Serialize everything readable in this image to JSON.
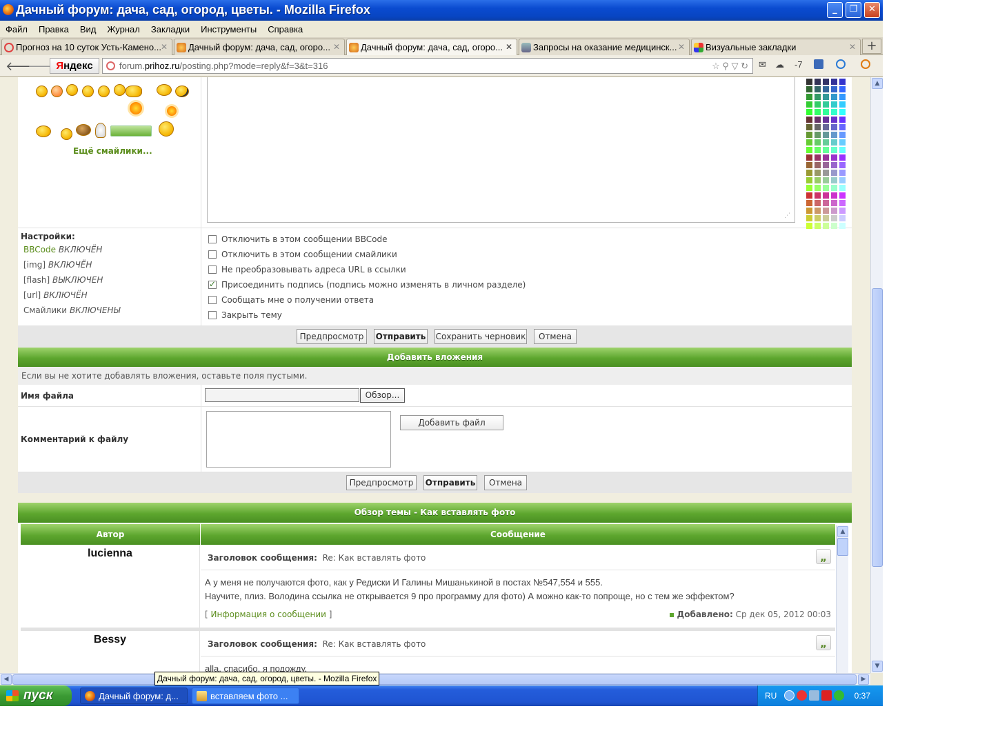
{
  "window": {
    "title": "Дачный форум: дача, сад, огород, цветы. - Mozilla Firefox",
    "buttons": {
      "minimize": "_",
      "maximize": "❐",
      "close": "✕"
    }
  },
  "menu": [
    "Файл",
    "Правка",
    "Вид",
    "Журнал",
    "Закладки",
    "Инструменты",
    "Справка"
  ],
  "tabs": [
    {
      "label": "Прогноз на 10 суток Усть-Камено...",
      "icon": "weather-icon",
      "active": false
    },
    {
      "label": "Дачный форум: дача, сад, огоро...",
      "icon": "forum-icon",
      "active": false
    },
    {
      "label": "Дачный форум: дача, сад, огоро...",
      "icon": "forum-icon",
      "active": true
    },
    {
      "label": "Запросы на оказание медицинск...",
      "icon": "page-icon",
      "active": false
    },
    {
      "label": "Визуальные закладки",
      "icon": "bookmarks-icon",
      "active": false
    }
  ],
  "tab_close": "✕",
  "new_tab": "+",
  "nav": {
    "back": "🡐",
    "forward": "🡒",
    "yandex": {
      "first": "Я",
      "rest": "ндекс"
    },
    "url": {
      "prefix": "forum.",
      "domain": "prihoz.ru",
      "path": "/posting.php?mode=reply&f=3&t=316"
    },
    "url_icons": "☆ ⚲ ▽ ↻",
    "weather_temp": "-7",
    "mail": "✉",
    "weather": "☁"
  },
  "smileys": {
    "more_link": "Ещё смайлики..."
  },
  "colors": {
    "accent": "#5da62e",
    "link": "#5b8d1c",
    "panel_bg": "#f1eedf"
  },
  "settings": {
    "title": "Настройки:",
    "items": [
      {
        "name": "BBCode",
        "state": "ВКЛЮЧЁН",
        "link": true
      },
      {
        "name": "[img]",
        "state": "ВКЛЮЧЁН",
        "link": false
      },
      {
        "name": "[flash]",
        "state": "ВЫКЛЮЧЕН",
        "link": false
      },
      {
        "name": "[url]",
        "state": "ВКЛЮЧЁН",
        "link": false
      },
      {
        "name": "Смайлики",
        "state": "ВКЛЮЧЕНЫ",
        "link": false
      }
    ],
    "options": [
      {
        "label": "Отключить в этом сообщении BBCode",
        "checked": false
      },
      {
        "label": "Отключить в этом сообщении смайлики",
        "checked": false
      },
      {
        "label": "Не преобразовывать адреса URL в ссылки",
        "checked": false
      },
      {
        "label": "Присоединить подпись (подпись можно изменять в личном разделе)",
        "checked": true
      },
      {
        "label": "Сообщать мне о получении ответа",
        "checked": false
      },
      {
        "label": "Закрыть тему",
        "checked": false
      }
    ]
  },
  "buttons1": {
    "preview": "Предпросмотр",
    "submit": "Отправить",
    "save": "Сохранить черновик",
    "cancel": "Отмена"
  },
  "attachments": {
    "header": "Добавить вложения",
    "hint": "Если вы не хотите добавлять вложения, оставьте поля пустыми.",
    "filename_label": "Имя файла",
    "browse": "Обзор...",
    "comment_label": "Комментарий к файлу",
    "add_file": "Добавить файл"
  },
  "buttons2": {
    "preview": "Предпросмотр",
    "submit": "Отправить",
    "cancel": "Отмена"
  },
  "review": {
    "header": "Обзор темы - Как вставлять фото",
    "col_author": "Автор",
    "col_message": "Сообщение",
    "subject_label": "Заголовок сообщения:",
    "quote": "„",
    "posts": [
      {
        "author": "lucienna",
        "subject": "Re: Как вставлять фото",
        "line1": "А у меня не получаются фото, как у Редиски И Галины Мишанькиной в постах №547,554 и 555.",
        "line2": "Научите, плиз. Володина ссылка не открывается 9 про программу для фото) А можно как-то попроще, но с тем же эффектом?",
        "info_open": "[",
        "info_link": "Информация о сообщении",
        "info_close": "]",
        "added_label": "Добавлено:",
        "added_value": "Ср дек 05, 2012 00:03"
      },
      {
        "author": "Bessy",
        "subject": "Re: Как вставлять фото",
        "line1": "alla, спасибо, я подожду."
      }
    ]
  },
  "tooltip": "Дачный форум: дача, сад, огород, цветы. - Mozilla Firefox",
  "taskbar": {
    "start": "пуск",
    "items": [
      {
        "label": "Дачный форум: д...",
        "icon": "firefox-icon"
      },
      {
        "label": "вставляем фото ...",
        "icon": "paint-icon"
      }
    ],
    "lang": "RU",
    "clock": "0:37"
  }
}
